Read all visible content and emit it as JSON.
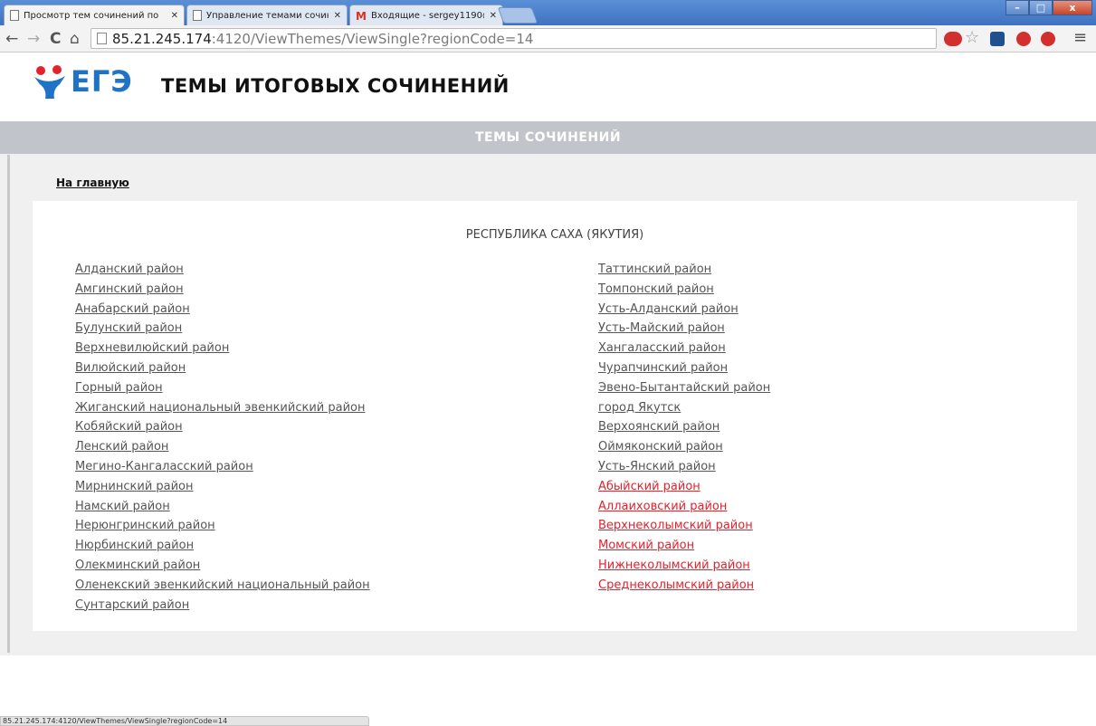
{
  "browser": {
    "tabs": [
      {
        "label": "Просмотр тем сочинений по",
        "active": true
      },
      {
        "label": "Управление темами сочине",
        "active": false
      },
      {
        "label": "Входящие - sergey1190@g",
        "active": false,
        "icon": "gmail-icon"
      }
    ],
    "url_host": "85.21.245.174",
    "url_rest": ":4120/ViewThemes/ViewSingle?regionCode=14",
    "window_buttons": {
      "minimize": "–",
      "maximize": "□",
      "close": "x"
    },
    "nav": {
      "back": "←",
      "forward": "→",
      "reload": "C",
      "home": "⌂"
    }
  },
  "header": {
    "logo_text": "ЕГЭ",
    "site_title": "ТЕМЫ ИТОГОВЫХ СОЧИНЕНИЙ"
  },
  "banner": {
    "title": "ТЕМЫ СОЧИНЕНИЙ"
  },
  "home_link": "На главную",
  "region": {
    "title": "РЕСПУБЛИКА САХА (ЯКУТИЯ)",
    "left_column": [
      "Алданский район",
      "Амгинский район",
      "Анабарский район",
      "Булунский район",
      "Верхневилюйский район",
      "Вилюйский район",
      "Горный район",
      "Жиганский национальный эвенкийский район",
      "Кобяйский район",
      "Ленский район",
      "Мегино-Кангаласский район",
      "Мирнинский район",
      "Намский район",
      "Нерюнгринский район",
      "Нюрбинский район",
      "Олекминский район",
      "Оленекский эвенкийский национальный район",
      "Сунтарский район"
    ],
    "right_column": [
      {
        "label": "Таттинский район",
        "highlight": false
      },
      {
        "label": "Томпонский район",
        "highlight": false
      },
      {
        "label": "Усть-Алданский район",
        "highlight": false
      },
      {
        "label": "Усть-Майский район",
        "highlight": false
      },
      {
        "label": "Хангаласский район",
        "highlight": false
      },
      {
        "label": "Чурапчинский район",
        "highlight": false
      },
      {
        "label": "Эвено-Бытантайский район",
        "highlight": false
      },
      {
        "label": "город Якутск",
        "highlight": false
      },
      {
        "label": "Верхоянский район",
        "highlight": false
      },
      {
        "label": "Оймяконский район",
        "highlight": false
      },
      {
        "label": "Усть-Янский район",
        "highlight": false
      },
      {
        "label": "Абыйский район",
        "highlight": true
      },
      {
        "label": "Аллаиховский район",
        "highlight": true
      },
      {
        "label": "Верхнеколымский район",
        "highlight": true
      },
      {
        "label": "Момский район",
        "highlight": true
      },
      {
        "label": "Нижнеколымский район",
        "highlight": true
      },
      {
        "label": "Среднеколымский район",
        "highlight": true
      }
    ]
  },
  "status_bar": "85.21.245.174:4120/ViewThemes/ViewSingle?regionCode=14",
  "colors": {
    "link": "#555555",
    "link_highlight": "#e2222c",
    "banner": "#c1c4ca",
    "brand_blue": "#1f73c7",
    "brand_red": "#e2222c"
  }
}
